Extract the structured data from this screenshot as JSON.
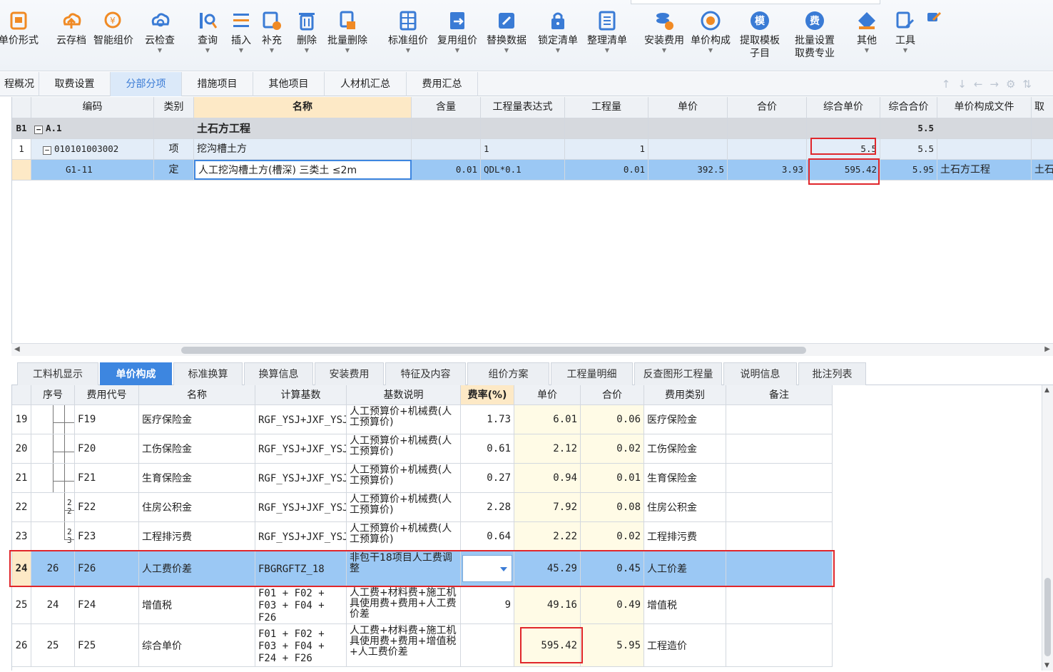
{
  "toolbar": {
    "items": [
      {
        "label": "单价形式",
        "icon": "price-form-icon",
        "color": "#f08a24"
      },
      {
        "label": "云存档",
        "icon": "cloud-upload-icon",
        "color": "#f08a24"
      },
      {
        "label": "智能组价",
        "icon": "smart-pricing-icon",
        "color": "#f08a24"
      },
      {
        "label": "云检查",
        "icon": "cloud-check-icon",
        "color": "#3a7bd5"
      },
      {
        "label": "查询",
        "icon": "query-icon",
        "color": "#3a7bd5"
      },
      {
        "label": "插入",
        "icon": "insert-icon",
        "color": "#3a7bd5"
      },
      {
        "label": "补充",
        "icon": "supplement-icon",
        "color": "#3a7bd5"
      },
      {
        "label": "删除",
        "icon": "delete-icon",
        "color": "#3a7bd5"
      },
      {
        "label": "批量删除",
        "icon": "batch-delete-icon",
        "color": "#3a7bd5"
      },
      {
        "label": "标准组价",
        "icon": "standard-pricing-icon",
        "color": "#3a7bd5"
      },
      {
        "label": "复用组价",
        "icon": "reuse-pricing-icon",
        "color": "#3a7bd5"
      },
      {
        "label": "替换数据",
        "icon": "replace-data-icon",
        "color": "#3a7bd5"
      },
      {
        "label": "锁定清单",
        "icon": "lock-list-icon",
        "color": "#3a7bd5"
      },
      {
        "label": "整理清单",
        "icon": "organize-list-icon",
        "color": "#3a7bd5"
      },
      {
        "label": "安装费用",
        "icon": "install-fee-icon",
        "color": "#3a7bd5"
      },
      {
        "label": "单价构成",
        "icon": "price-composition-icon",
        "color": "#3a7bd5"
      },
      {
        "label": "提取模板",
        "label2": "子目",
        "icon": "template-icon",
        "color": "#3a7bd5",
        "glyph": "模"
      },
      {
        "label": "批量设置",
        "label2": "取费专业",
        "icon": "fee-setting-icon",
        "color": "#3a7bd5",
        "glyph": "费"
      },
      {
        "label": "其他",
        "icon": "other-icon",
        "color": "#3a7bd5"
      },
      {
        "label": "工具",
        "icon": "tools-icon",
        "color": "#3a7bd5"
      }
    ]
  },
  "main_tabs": [
    "程概况",
    "取费设置",
    "分部分项",
    "措施项目",
    "其他项目",
    "人材机汇总",
    "费用汇总"
  ],
  "main_tabs_active": 2,
  "top_grid": {
    "headers": [
      "编码",
      "类别",
      "名称",
      "含量",
      "工程量表达式",
      "工程量",
      "单价",
      "合价",
      "综合单价",
      "综合合价",
      "单价构成文件",
      "取"
    ],
    "rows": [
      {
        "num": "B1",
        "tree": "−",
        "code": "A.1",
        "type": "",
        "name": "土石方工程",
        "content": "",
        "expr": "",
        "qty": "",
        "price": "",
        "total": "",
        "unit_price": "",
        "unit_total": "5.5",
        "file": "",
        "extra": ""
      },
      {
        "num": "1",
        "tree": "−",
        "code": "010101003002",
        "type": "项",
        "name": "挖沟槽土方",
        "content": "",
        "expr": "1",
        "qty": "1",
        "price": "",
        "total": "",
        "unit_price": "5.5",
        "unit_total": "5.5",
        "file": "",
        "extra": ""
      },
      {
        "num": "",
        "tree": "",
        "code": "G1-11",
        "type": "定",
        "name": "人工挖沟槽土方(槽深) 三类土 ≤2m",
        "content": "0.01",
        "expr": "QDL*0.1",
        "qty": "0.01",
        "price": "392.5",
        "total": "3.93",
        "unit_price": "595.42",
        "unit_total": "5.95",
        "file": "土石方工程",
        "extra": "土石"
      }
    ]
  },
  "sub_tabs": [
    "工料机显示",
    "单价构成",
    "标准换算",
    "换算信息",
    "安装费用",
    "特征及内容",
    "组价方案",
    "工程量明细",
    "反查图形工程量",
    "说明信息",
    "批注列表"
  ],
  "sub_tabs_active": 1,
  "bottom_grid": {
    "headers": [
      "序号",
      "费用代号",
      "名称",
      "计算基数",
      "基数说明",
      "费率(%)",
      "单价",
      "合价",
      "费用类别",
      "备注"
    ],
    "rows": [
      {
        "num": "19",
        "seq": "",
        "tree": "",
        "code": "F19",
        "name": "医疗保险金",
        "base": "RGF_YSJ+JXF_YSJ",
        "desc": "人工预算价+机械费(人工预算价)",
        "rate": "1.73",
        "price": "6.01",
        "total": "0.06",
        "cat": "医疗保险金",
        "note": ""
      },
      {
        "num": "20",
        "seq": "",
        "tree": "",
        "code": "F20",
        "name": "工伤保险金",
        "base": "RGF_YSJ+JXF_YSJ",
        "desc": "人工预算价+机械费(人工预算价)",
        "rate": "0.61",
        "price": "2.12",
        "total": "0.02",
        "cat": "工伤保险金",
        "note": ""
      },
      {
        "num": "21",
        "seq": "",
        "tree": "",
        "code": "F21",
        "name": "生育保险金",
        "base": "RGF_YSJ+JXF_YSJ",
        "desc": "人工预算价+机械费(人工预算价)",
        "rate": "0.27",
        "price": "0.94",
        "total": "0.01",
        "cat": "生育保险金",
        "note": ""
      },
      {
        "num": "22",
        "seq": "",
        "tree": "2\n2",
        "code": "F22",
        "name": "住房公积金",
        "base": "RGF_YSJ+JXF_YSJ",
        "desc": "人工预算价+机械费(人工预算价)",
        "rate": "2.28",
        "price": "7.92",
        "total": "0.08",
        "cat": "住房公积金",
        "note": ""
      },
      {
        "num": "23",
        "seq": "",
        "tree": "2\n3",
        "code": "F23",
        "name": "工程排污费",
        "base": "RGF_YSJ+JXF_YSJ",
        "desc": "人工预算价+机械费(人工预算价)",
        "rate": "0.64",
        "price": "2.22",
        "total": "0.02",
        "cat": "工程排污费",
        "note": ""
      },
      {
        "num": "24",
        "seq": "26",
        "tree": "",
        "code": "F26",
        "name": "人工费价差",
        "base": "FBGRGFTZ_18",
        "desc": "非包干18项目人工费调整",
        "rate": "",
        "price": "45.29",
        "total": "0.45",
        "cat": "人工价差",
        "note": ""
      },
      {
        "num": "25",
        "seq": "24",
        "tree": "",
        "code": "F24",
        "name": "增值税",
        "base": "F01 + F02 + F03 + F04 + F26",
        "desc": "人工费+材料费+施工机具使用费+费用+人工费价差",
        "rate": "9",
        "price": "49.16",
        "total": "0.49",
        "cat": "增值税",
        "note": ""
      },
      {
        "num": "26",
        "seq": "25",
        "tree": "",
        "code": "F25",
        "name": "综合单价",
        "base": "F01 + F02 + F03 + F04 + F24 + F26",
        "desc": "人工费+材料费+施工机具使用费+费用+增值税+人工费价差",
        "rate": "",
        "price": "595.42",
        "total": "5.95",
        "cat": "工程造价",
        "note": ""
      }
    ]
  },
  "colors": {
    "accent": "#3d86e0",
    "selected_row": "#9bc8f4",
    "highlight": "#e0262b",
    "header_name": "#fde9c6"
  }
}
